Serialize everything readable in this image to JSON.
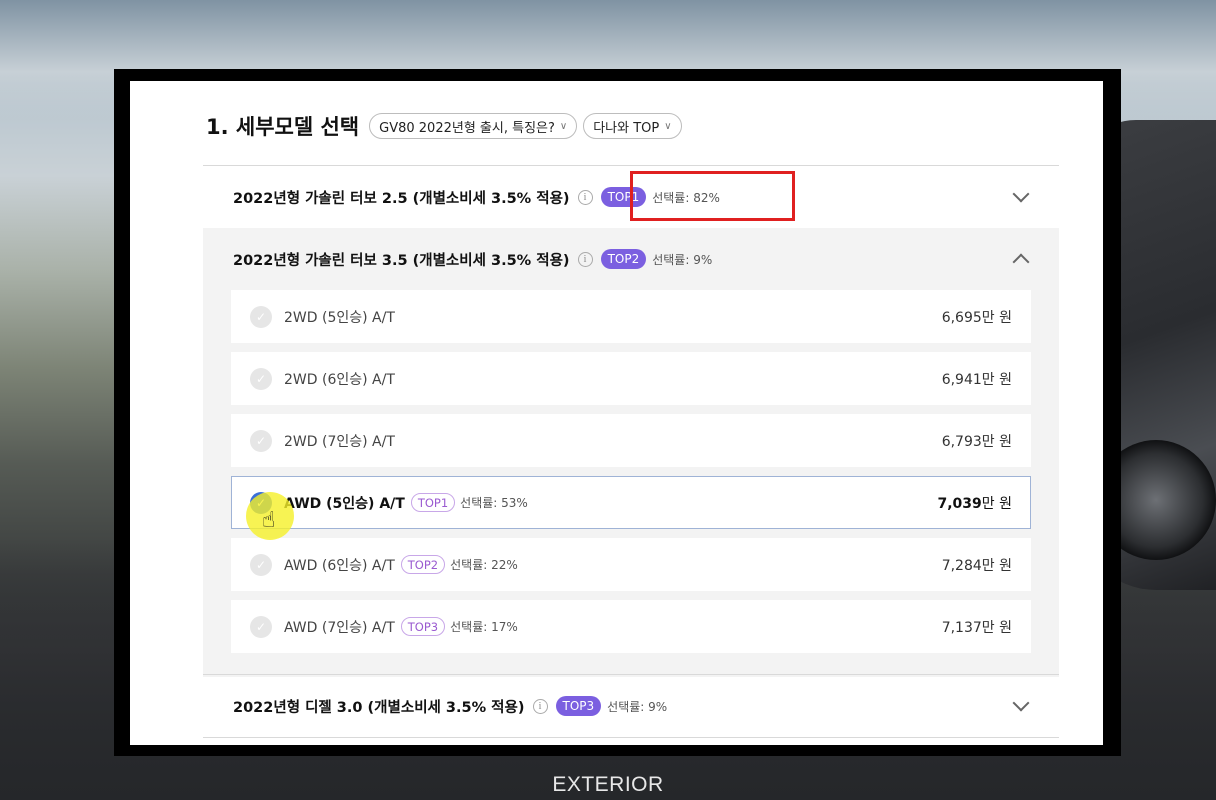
{
  "background": {
    "caption": "EXTERIOR"
  },
  "header": {
    "title": "1. 세부모델 선택",
    "pills": [
      "GV80 2022년형 출시, 특징은?",
      "다나와 TOP"
    ]
  },
  "sections": [
    {
      "title": "2022년형 가솔린 터보 2.5 (개별소비세 3.5% 적용)",
      "badge": "TOP1",
      "rate": "선택률: 82%",
      "expanded": false
    },
    {
      "title": "2022년형 가솔린 터보 3.5 (개별소비세 3.5% 적용)",
      "badge": "TOP2",
      "rate": "선택률: 9%",
      "expanded": true,
      "rows": [
        {
          "label": "2WD (5인승) A/T",
          "tag": "",
          "rate": "",
          "price_num": "6,695",
          "price_unit": "만 원",
          "selected": false
        },
        {
          "label": "2WD (6인승) A/T",
          "tag": "",
          "rate": "",
          "price_num": "6,941",
          "price_unit": "만 원",
          "selected": false
        },
        {
          "label": "2WD (7인승) A/T",
          "tag": "",
          "rate": "",
          "price_num": "6,793",
          "price_unit": "만 원",
          "selected": false
        },
        {
          "label": "AWD (5인승) A/T",
          "tag": "TOP1",
          "rate": "선택률: 53%",
          "price_num": "7,039",
          "price_unit": "만 원",
          "selected": true
        },
        {
          "label": "AWD (6인승) A/T",
          "tag": "TOP2",
          "rate": "선택률: 22%",
          "price_num": "7,284",
          "price_unit": "만 원",
          "selected": false
        },
        {
          "label": "AWD (7인승) A/T",
          "tag": "TOP3",
          "rate": "선택률: 17%",
          "price_num": "7,137",
          "price_unit": "만 원",
          "selected": false
        }
      ]
    },
    {
      "title": "2022년형 디젤 3.0 (개별소비세 3.5% 적용)",
      "badge": "TOP3",
      "rate": "선택률: 9%",
      "expanded": false
    }
  ],
  "icons": {
    "info": "i",
    "check": "✓",
    "chevron": "∨",
    "cursor": "☝"
  }
}
